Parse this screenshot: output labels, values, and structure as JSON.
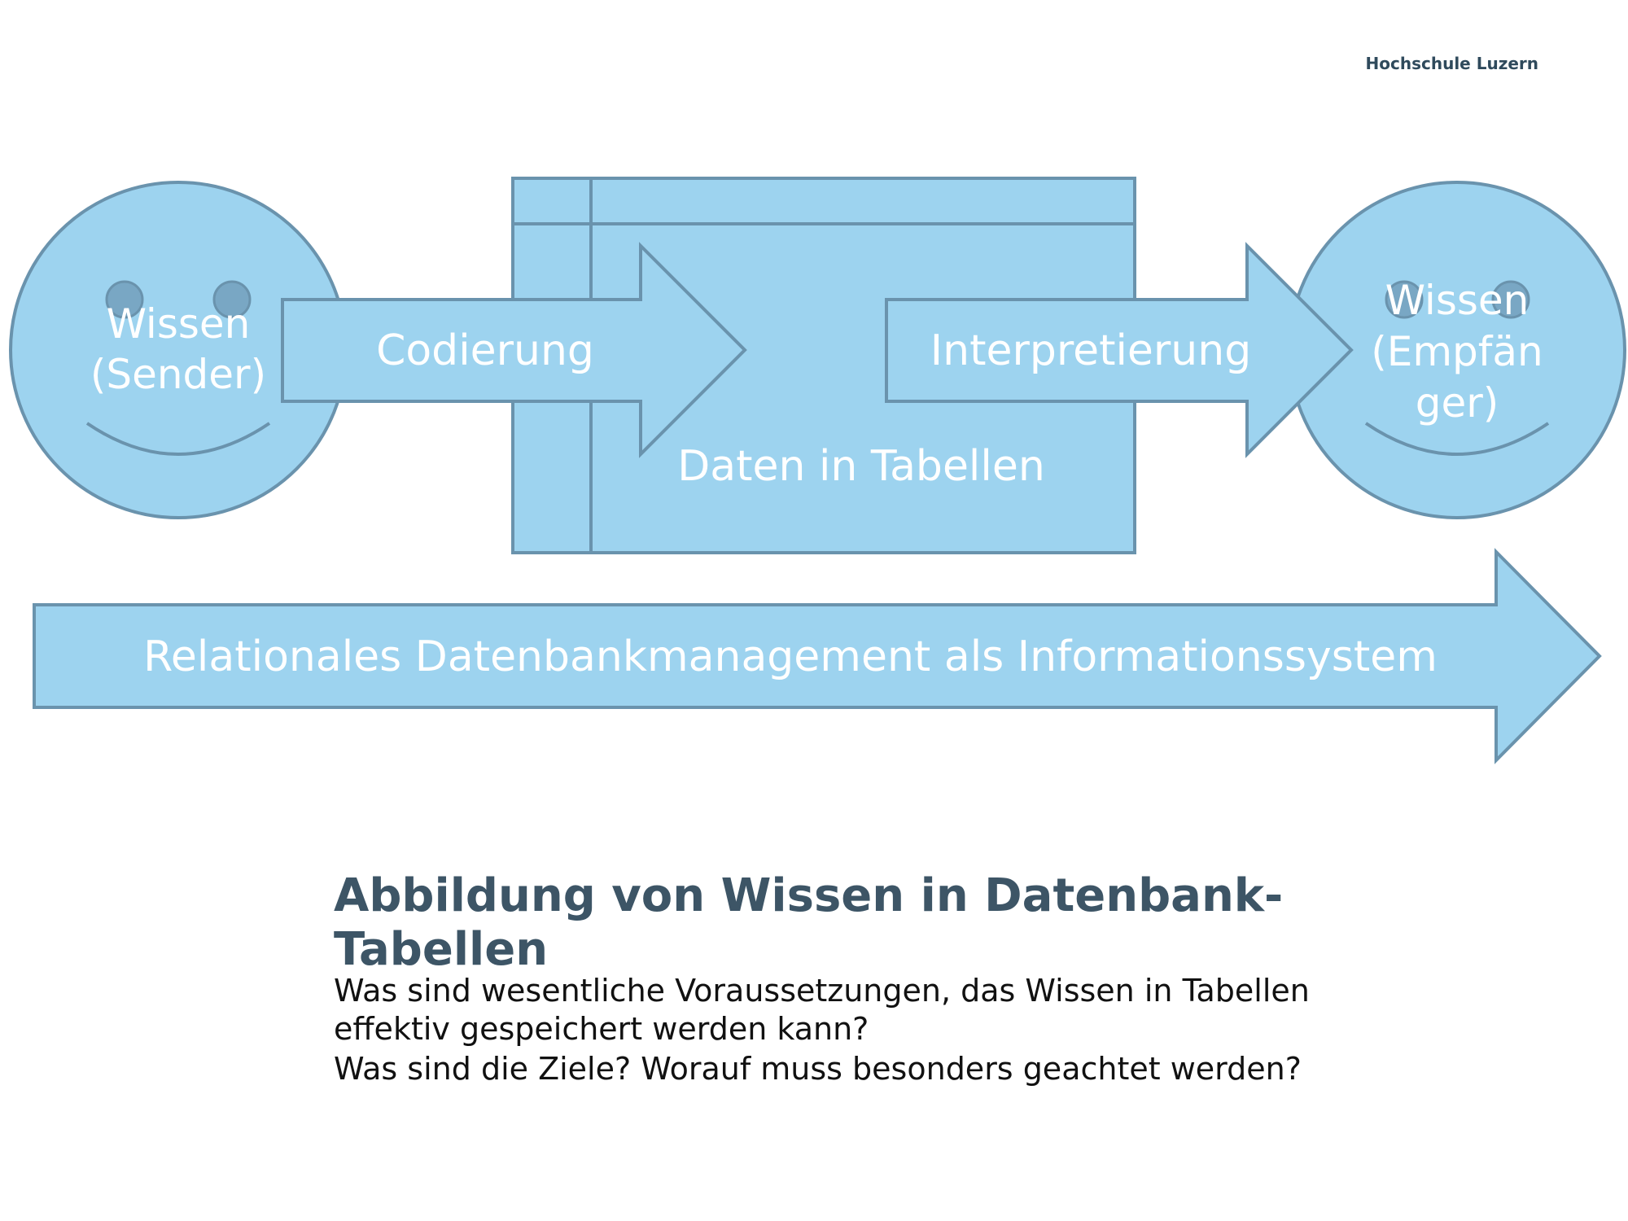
{
  "header": {
    "institution": "Hochschule Luzern"
  },
  "colors": {
    "fill": "#9dd3ef",
    "stroke": "#6a93ad",
    "eye": "#79a7c4",
    "label": "#ffffff",
    "title": "#3d5566"
  },
  "diagram": {
    "sender": "Wissen\n(Sender)",
    "codierung": "Codierung",
    "table": "Daten in Tabellen",
    "interpretierung": "Interpretierung",
    "receiver": "Wissen\n(Empfän\nger)",
    "system": "Relationales Datenbankmanagement als Informationssystem"
  },
  "caption": {
    "title": "Abbildung von Wissen in Datenbank-Tabellen",
    "question1": "Was sind wesentliche Voraussetzungen, das Wissen in Tabellen effektiv gespeichert werden kann?",
    "question2": "Was sind die Ziele? Worauf muss besonders geachtet werden?"
  }
}
